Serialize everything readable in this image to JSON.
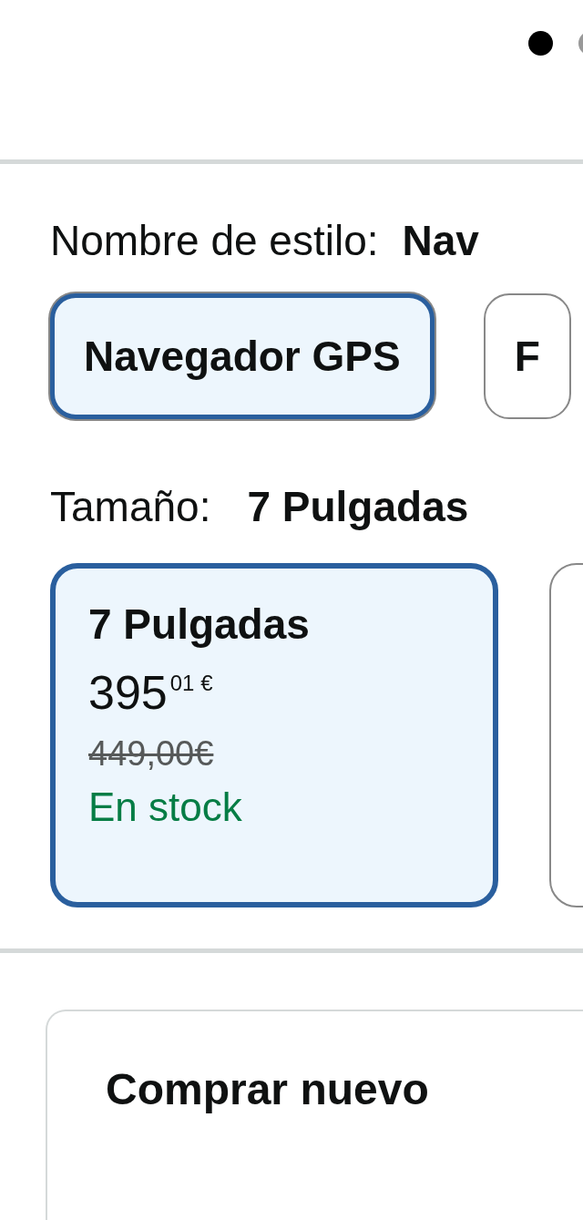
{
  "carousel_dots": [
    {
      "selected": true
    },
    {
      "selected": false
    }
  ],
  "style": {
    "label": "Nombre de estilo:",
    "value": "Nav",
    "options": [
      {
        "label": "Navegador GPS",
        "selected": true
      },
      {
        "label": "F",
        "selected": false
      }
    ]
  },
  "size": {
    "label": "Tamaño:",
    "value": "7 Pulgadas",
    "options": [
      {
        "title": "7 Pulgadas",
        "price_whole": "395",
        "price_fraction": "01",
        "currency": "€",
        "list_price": "449,00€",
        "availability": "En stock",
        "selected": true
      },
      {
        "selected": false
      }
    ]
  },
  "buy_box": {
    "title": "Comprar nuevo"
  }
}
